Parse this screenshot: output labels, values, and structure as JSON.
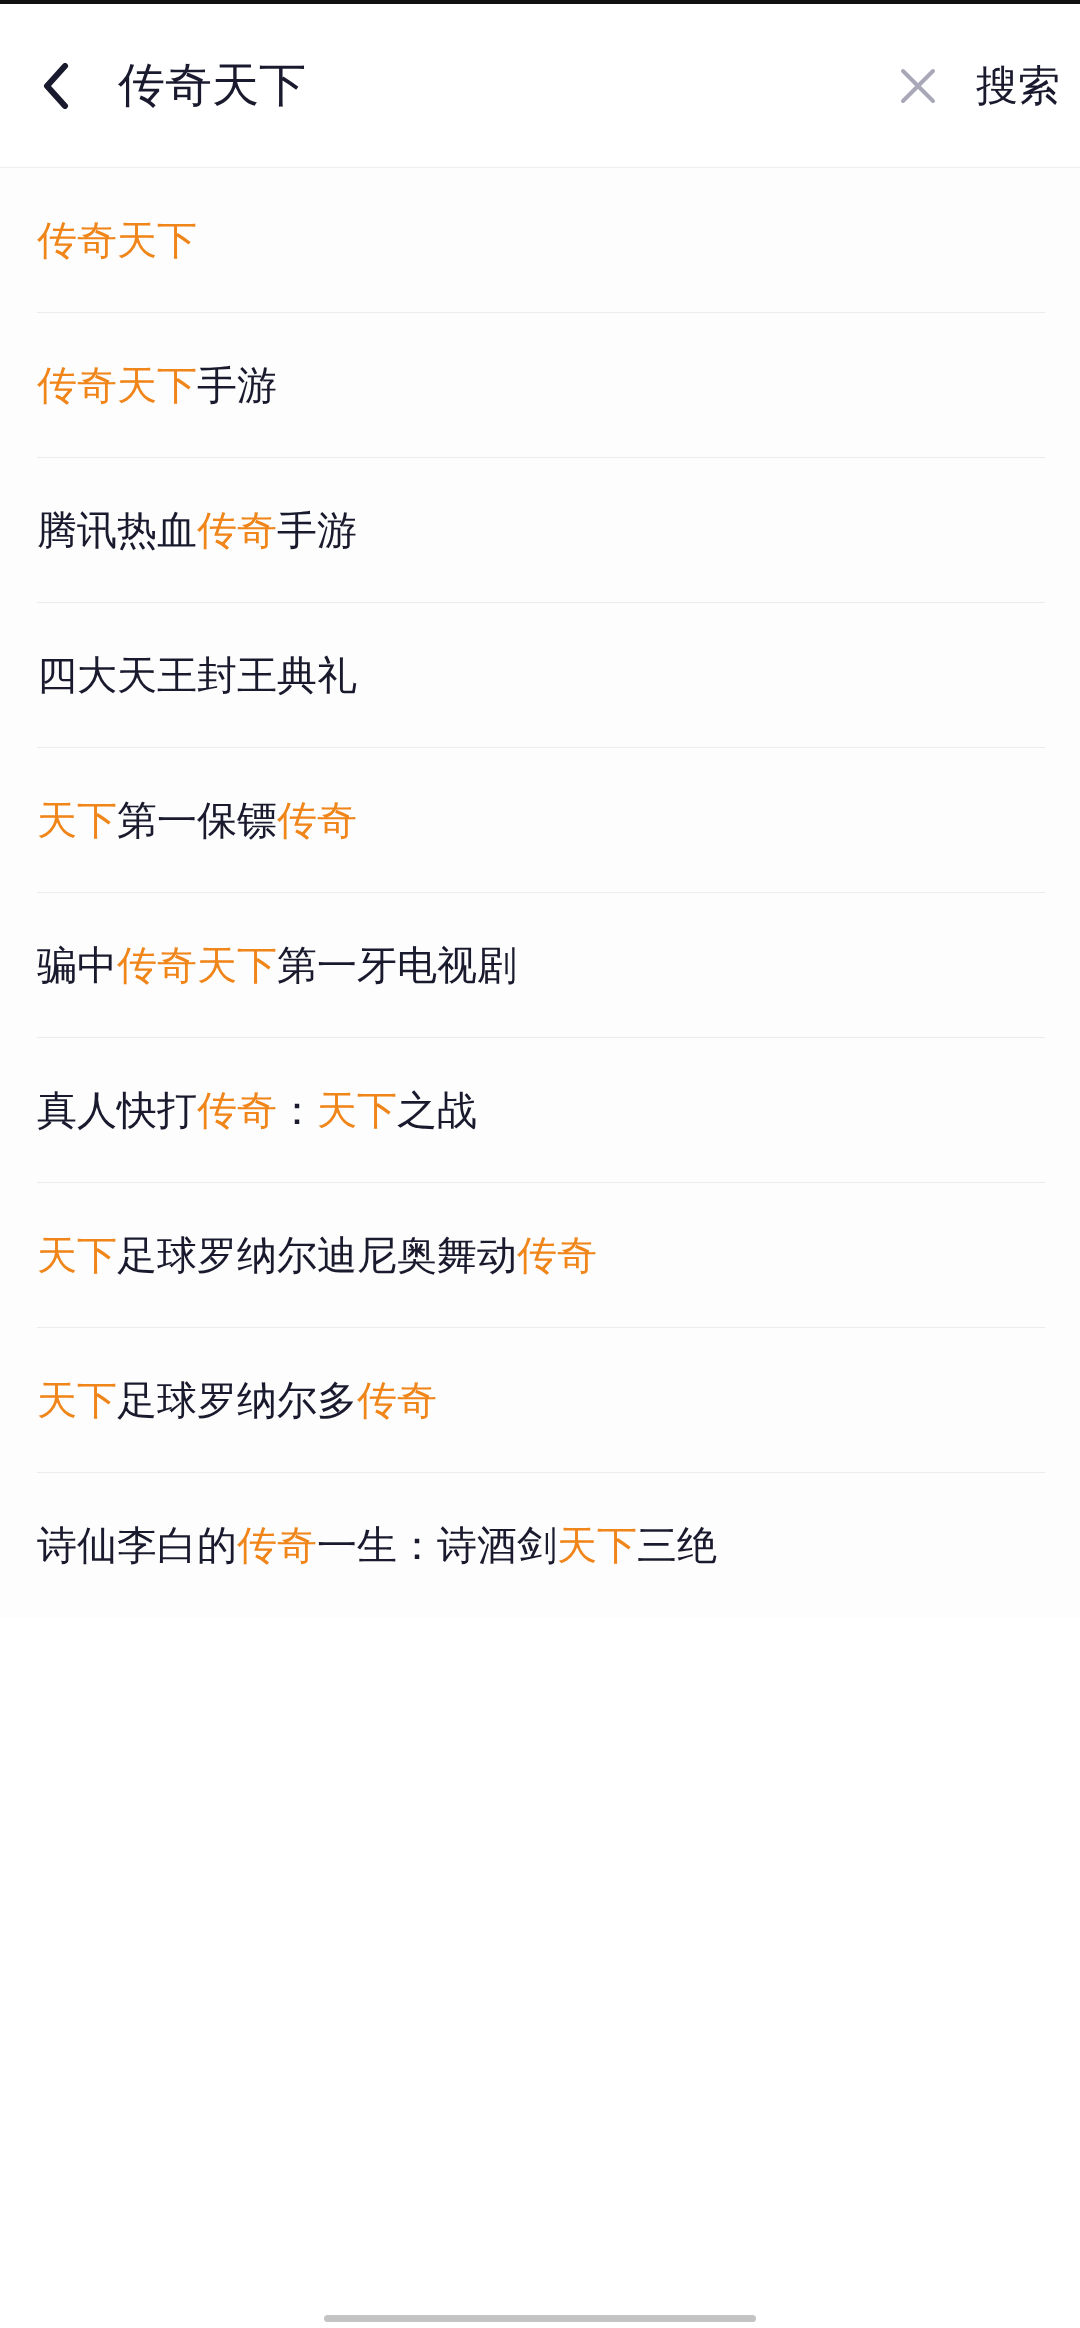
{
  "header": {
    "query": "传奇天下",
    "search_button": "搜索"
  },
  "suggestions": [
    {
      "parts": [
        {
          "text": "传奇天下",
          "highlighted": true
        }
      ]
    },
    {
      "parts": [
        {
          "text": "传奇天下",
          "highlighted": true
        },
        {
          "text": "手游",
          "highlighted": false
        }
      ]
    },
    {
      "parts": [
        {
          "text": "腾讯热血",
          "highlighted": false
        },
        {
          "text": "传奇",
          "highlighted": true
        },
        {
          "text": "手游",
          "highlighted": false
        }
      ]
    },
    {
      "parts": [
        {
          "text": "四大天王封王典礼",
          "highlighted": false
        }
      ]
    },
    {
      "parts": [
        {
          "text": "天下",
          "highlighted": true
        },
        {
          "text": "第一保镖",
          "highlighted": false
        },
        {
          "text": "传奇",
          "highlighted": true
        }
      ]
    },
    {
      "parts": [
        {
          "text": "骗中",
          "highlighted": false
        },
        {
          "text": "传奇天下",
          "highlighted": true
        },
        {
          "text": "第一牙电视剧",
          "highlighted": false
        }
      ]
    },
    {
      "parts": [
        {
          "text": "真人快打",
          "highlighted": false
        },
        {
          "text": "传奇",
          "highlighted": true
        },
        {
          "text": "：",
          "highlighted": false
        },
        {
          "text": "天下",
          "highlighted": true
        },
        {
          "text": "之战",
          "highlighted": false
        }
      ]
    },
    {
      "parts": [
        {
          "text": "天下",
          "highlighted": true
        },
        {
          "text": "足球罗纳尔迪尼奥舞动",
          "highlighted": false
        },
        {
          "text": "传奇",
          "highlighted": true
        }
      ]
    },
    {
      "parts": [
        {
          "text": "天下",
          "highlighted": true
        },
        {
          "text": "足球罗纳尔多",
          "highlighted": false
        },
        {
          "text": "传奇",
          "highlighted": true
        }
      ]
    },
    {
      "parts": [
        {
          "text": "诗仙李白的",
          "highlighted": false
        },
        {
          "text": "传奇",
          "highlighted": true
        },
        {
          "text": "一生：诗酒剑",
          "highlighted": false
        },
        {
          "text": "天下",
          "highlighted": true
        },
        {
          "text": "三绝",
          "highlighted": false
        }
      ]
    }
  ]
}
